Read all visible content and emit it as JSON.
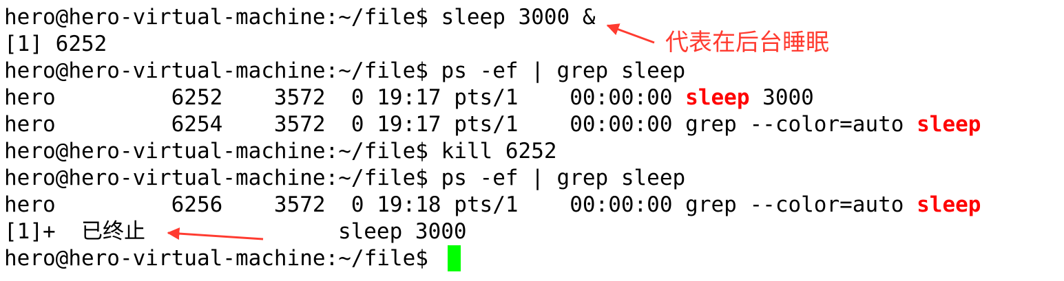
{
  "terminal": {
    "lines": [
      {
        "segments": [
          {
            "text": "hero@hero-virtual-machine:~/file$ sleep 3000 &"
          }
        ]
      },
      {
        "segments": [
          {
            "text": "[1] 6252"
          }
        ]
      },
      {
        "segments": [
          {
            "text": "hero@hero-virtual-machine:~/file$ ps -ef | grep sleep"
          }
        ]
      },
      {
        "segments": [
          {
            "text": "hero         6252    3572  0 19:17 pts/1    00:00:00 "
          },
          {
            "text": "sleep",
            "highlight": true
          },
          {
            "text": " 3000"
          }
        ]
      },
      {
        "segments": [
          {
            "text": "hero         6254    3572  0 19:17 pts/1    00:00:00 grep --color=auto "
          },
          {
            "text": "sleep",
            "highlight": true
          }
        ]
      },
      {
        "segments": [
          {
            "text": "hero@hero-virtual-machine:~/file$ kill 6252"
          }
        ]
      },
      {
        "segments": [
          {
            "text": "hero@hero-virtual-machine:~/file$ ps -ef | grep sleep"
          }
        ]
      },
      {
        "segments": [
          {
            "text": "hero         6256    3572  0 19:18 pts/1    00:00:00 grep --color=auto "
          },
          {
            "text": "sleep",
            "highlight": true
          }
        ]
      },
      {
        "segments": [
          {
            "text": "[1]+  "
          },
          {
            "text": "已终止",
            "cjk": true
          },
          {
            "text": "               sleep 3000"
          }
        ]
      },
      {
        "segments": [
          {
            "text": "hero@hero-virtual-machine:~/file$ "
          }
        ]
      }
    ]
  },
  "annotation": {
    "text": "代表在后台睡眠"
  },
  "colors": {
    "background": "#ffffff",
    "text": "#000000",
    "highlight": "#ff0000",
    "cursor": "#00ff00",
    "annotation": "#ff3b30"
  }
}
